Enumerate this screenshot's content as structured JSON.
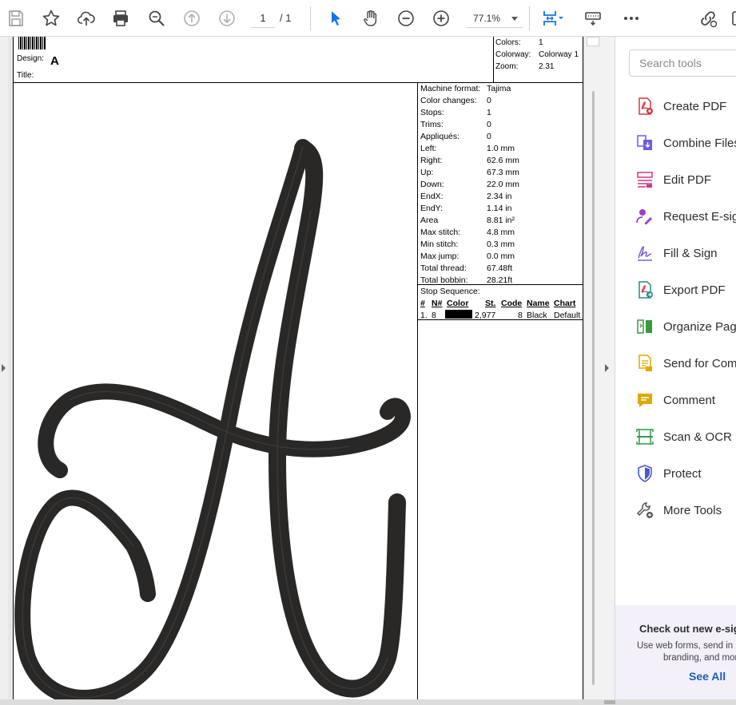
{
  "toolbar": {
    "page_current": "1",
    "page_total": "/ 1",
    "zoom": "77.1%",
    "icons": [
      "save-icon",
      "bookmark-star-icon",
      "upload-cloud-icon",
      "print-icon",
      "zoom-search-icon",
      "page-up-icon",
      "page-down-icon",
      "select-cursor-icon",
      "hand-tool-icon",
      "zoom-out-icon",
      "zoom-in-icon",
      "fit-page-icon",
      "keyboard-icon",
      "more-icon",
      "share-link-icon"
    ]
  },
  "document": {
    "header": {
      "design_label": "Design:",
      "design_value": "A",
      "title_label": "Title:",
      "colors_label": "Colors:",
      "colors_value": "1",
      "colorway_label": "Colorway:",
      "colorway_value": "Colorway 1",
      "zoom_label": "Zoom:",
      "zoom_value": "2.31"
    },
    "stats": [
      {
        "k": "Machine format:",
        "v": "Tajima"
      },
      {
        "k": "Color changes:",
        "v": "0"
      },
      {
        "k": "Stops:",
        "v": "1"
      },
      {
        "k": "Trims:",
        "v": "0"
      },
      {
        "k": "Appliqués:",
        "v": "0"
      },
      {
        "k": "Left:",
        "v": "1.0 mm"
      },
      {
        "k": "Right:",
        "v": "62.6 mm"
      },
      {
        "k": "Up:",
        "v": "67.3 mm"
      },
      {
        "k": "Down:",
        "v": "22.0 mm"
      },
      {
        "k": "EndX:",
        "v": "2.34 in"
      },
      {
        "k": "EndY:",
        "v": "1.14 in"
      },
      {
        "k": "Area",
        "v": "  8.81 in²"
      },
      {
        "k": "Max stitch:",
        "v": "4.8 mm"
      },
      {
        "k": "Min stitch:",
        "v": "0.3 mm"
      },
      {
        "k": "Max jump:",
        "v": "0.0 mm"
      },
      {
        "k": "Total thread:",
        "v": "67.48ft"
      },
      {
        "k": "Total bobbin:",
        "v": "28.21ft"
      }
    ],
    "stop_sequence": {
      "title": "Stop Sequence:",
      "headers": {
        "num": "#",
        "n": "N#",
        "color": "Color",
        "st": "St.",
        "code": "Code",
        "name": "Name",
        "chart": "Chart"
      },
      "row": {
        "num": "1.",
        "n": "8",
        "st": "2,977",
        "code": "8",
        "name": "Black",
        "chart": "Default",
        "swatch": "#000000"
      }
    }
  },
  "tools_pane": {
    "search_placeholder": "Search tools",
    "items": [
      {
        "label": "Create PDF",
        "icon": "create-pdf-icon",
        "color": "#d7373f"
      },
      {
        "label": "Combine Files",
        "icon": "combine-files-icon",
        "color": "#6b5de0"
      },
      {
        "label": "Edit PDF",
        "icon": "edit-pdf-icon",
        "color": "#d63384"
      },
      {
        "label": "Request E-signatures",
        "icon": "request-esign-icon",
        "color": "#9b3bd1"
      },
      {
        "label": "Fill & Sign",
        "icon": "fill-sign-icon",
        "color": "#7b5bd6"
      },
      {
        "label": "Export PDF",
        "icon": "export-pdf-icon",
        "color": "#2a8a8a"
      },
      {
        "label": "Organize Pages",
        "icon": "organize-pages-icon",
        "color": "#3a9a3a"
      },
      {
        "label": "Send for Comments",
        "icon": "send-comments-icon",
        "color": "#e0a800"
      },
      {
        "label": "Comment",
        "icon": "comment-icon",
        "color": "#e0a800"
      },
      {
        "label": "Scan & OCR",
        "icon": "scan-ocr-icon",
        "color": "#2e9b4a"
      },
      {
        "label": "Protect",
        "icon": "protect-icon",
        "color": "#4a56c9"
      },
      {
        "label": "More Tools",
        "icon": "more-tools-icon",
        "color": "#555555"
      }
    ],
    "promo": {
      "title": "Check out new e-sign",
      "line1": "Use web forms, send in bulk,",
      "line2": "branding, and more.",
      "link": "See All"
    }
  }
}
